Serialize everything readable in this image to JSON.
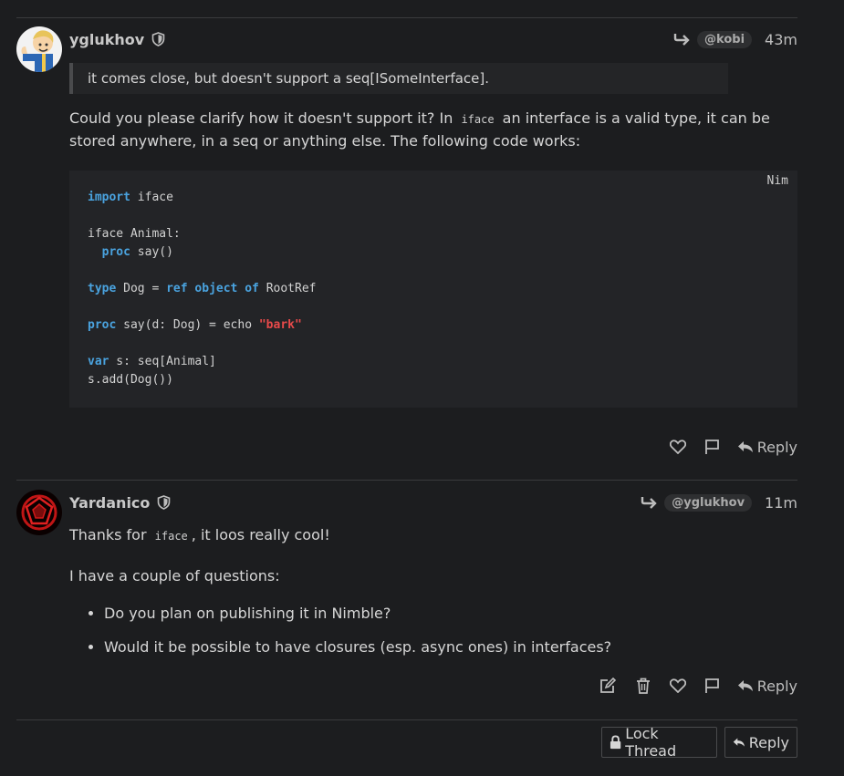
{
  "posts": [
    {
      "username": "yglukhov",
      "reply_to": "@kobi",
      "time": "43m",
      "quote": "it comes close, but doesn't support a seq[ISomeInterface].",
      "para_before": "Could you please clarify how it doesn't support it? In ",
      "inline_code": "iface",
      "para_after": " an interface is a valid type, it can be stored anywhere, in a seq or anything else. The following code works:",
      "code_lang": "Nim",
      "reply_label": "Reply"
    },
    {
      "username": "Yardanico",
      "reply_to": "@yglukhov",
      "time": "11m",
      "para1_before": "Thanks for ",
      "inline_code": "iface",
      "para1_after": ", it loos really cool!",
      "para2": "I have a couple of questions:",
      "bullets": [
        "Do you plan on publishing it in Nimble?",
        "Would it be possible to have closures (esp. async ones) in interfaces?"
      ],
      "reply_label": "Reply"
    }
  ],
  "code": {
    "import_kw": "import",
    "import_rest": " iface",
    "iface_line": "iface Animal:",
    "proc_kw": "proc",
    "say_decl": " say()",
    "type_kw": "type",
    "dog_eq": " Dog = ",
    "ref_kw": "ref",
    "object_kw": "object",
    "of_kw": "of",
    "rootref": " RootRef",
    "say_impl": " say(d: Dog) = echo ",
    "bark_str": "\"bark\"",
    "var_kw": "var",
    "var_rest": " s: seq[Animal]",
    "add_line": "s.add(Dog())"
  },
  "footer": {
    "lock_label": "Lock Thread",
    "reply_label": "Reply"
  }
}
